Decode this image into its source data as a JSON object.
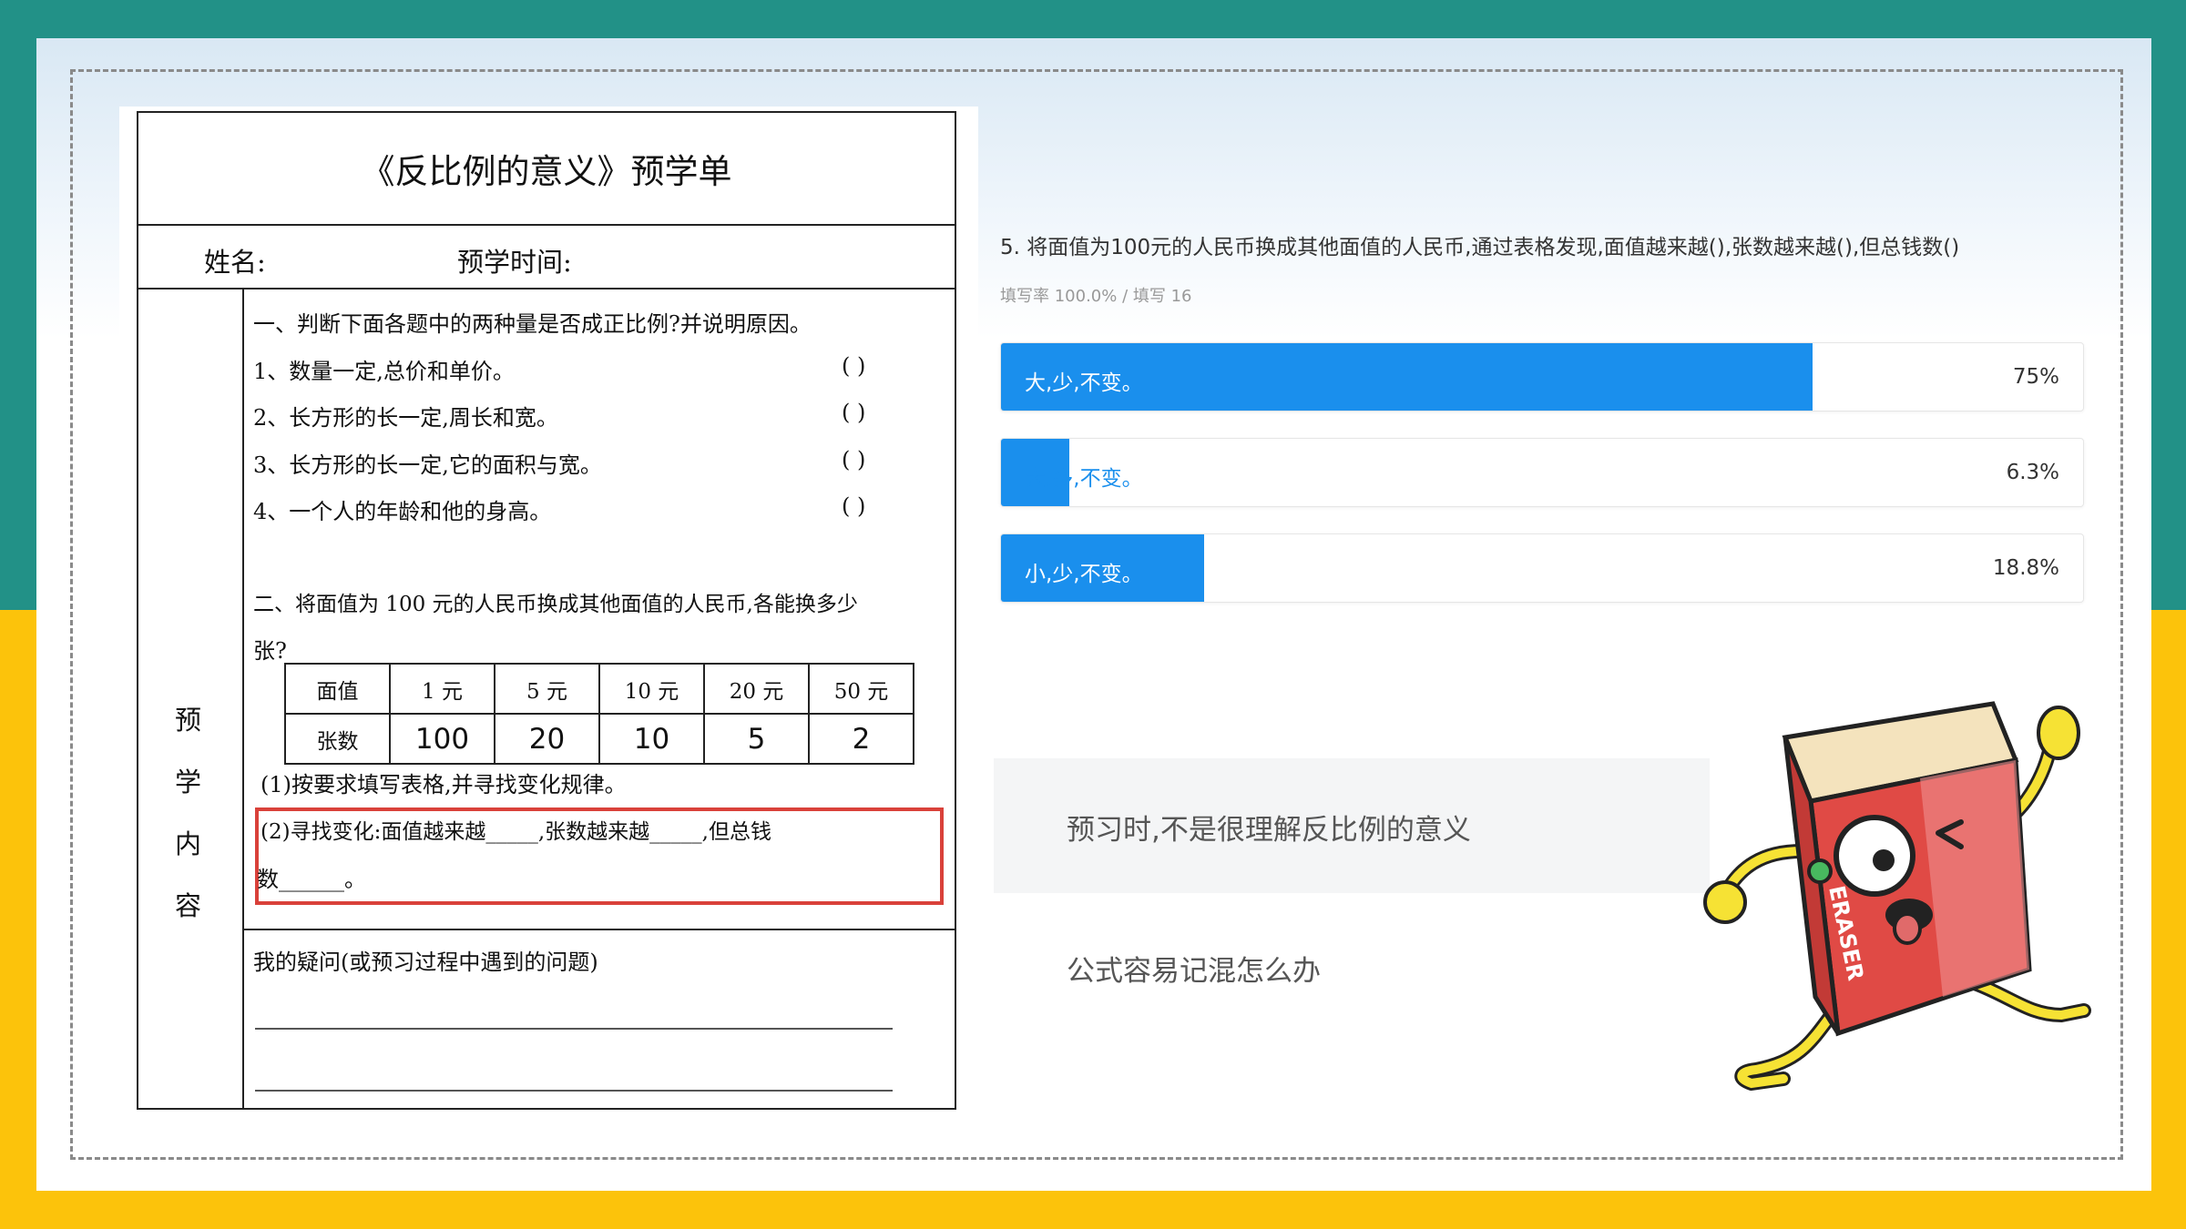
{
  "worksheet": {
    "title": "《反比例的意义》预学单",
    "name_label": "姓名:",
    "time_label": "预学时间:",
    "side_label": [
      "预",
      "学",
      "内",
      "容"
    ],
    "part1": {
      "heading": "一、判断下面各题中的两种量是否成正比例?并说明原因。",
      "items": [
        {
          "text": "1、数量一定,总价和单价。",
          "paren": "(        )"
        },
        {
          "text": "2、长方形的长一定,周长和宽。",
          "paren": "(        )"
        },
        {
          "text": "3、长方形的长一定,它的面积与宽。",
          "paren": "(        )"
        },
        {
          "text": "4、一个人的年龄和他的身高。",
          "paren": "(        )"
        }
      ]
    },
    "part2": {
      "heading_line1": "二、将面值为 100 元的人民币换成其他面值的人民币,各能换多少",
      "heading_line2": "张?",
      "table": {
        "header": [
          "面值",
          "1 元",
          "5 元",
          "10 元",
          "20 元",
          "50 元"
        ],
        "row": [
          "张数",
          "100",
          "20",
          "10",
          "5",
          "2"
        ]
      },
      "sub1": "(1)按要求填写表格,并寻找变化规律。",
      "sub2_line1": "(2)寻找变化:面值越来越_____,张数越来越_____,但总钱",
      "sub2_line2": "数______。"
    },
    "questions_label": "我的疑问(或预习过程中遇到的问题)"
  },
  "survey": {
    "question": "5. 将面值为100元的人民币换成其他面值的人民币,通过表格发现,面值越来越(),张数越来越(),但总钱数()",
    "fill_rate": "填写率 100.0% / 填写 16",
    "options": [
      {
        "label": "大,少,不变。",
        "percent": "75%",
        "value": 75
      },
      {
        "label": "大,多,不变。",
        "percent": "6.3%",
        "value": 6.3
      },
      {
        "label": "小,少,不变。",
        "percent": "18.8%",
        "value": 18.8
      }
    ],
    "bar_color": "#1a8fed"
  },
  "comments": [
    "预习时,不是很理解反比例的意义",
    "公式容易记混怎么办"
  ],
  "illustration": {
    "icon": "eraser-mascot-icon",
    "text": "ERASER"
  },
  "colors": {
    "teal": "#229187",
    "yellow": "#fcc30b",
    "red_highlight": "#d9413a"
  }
}
